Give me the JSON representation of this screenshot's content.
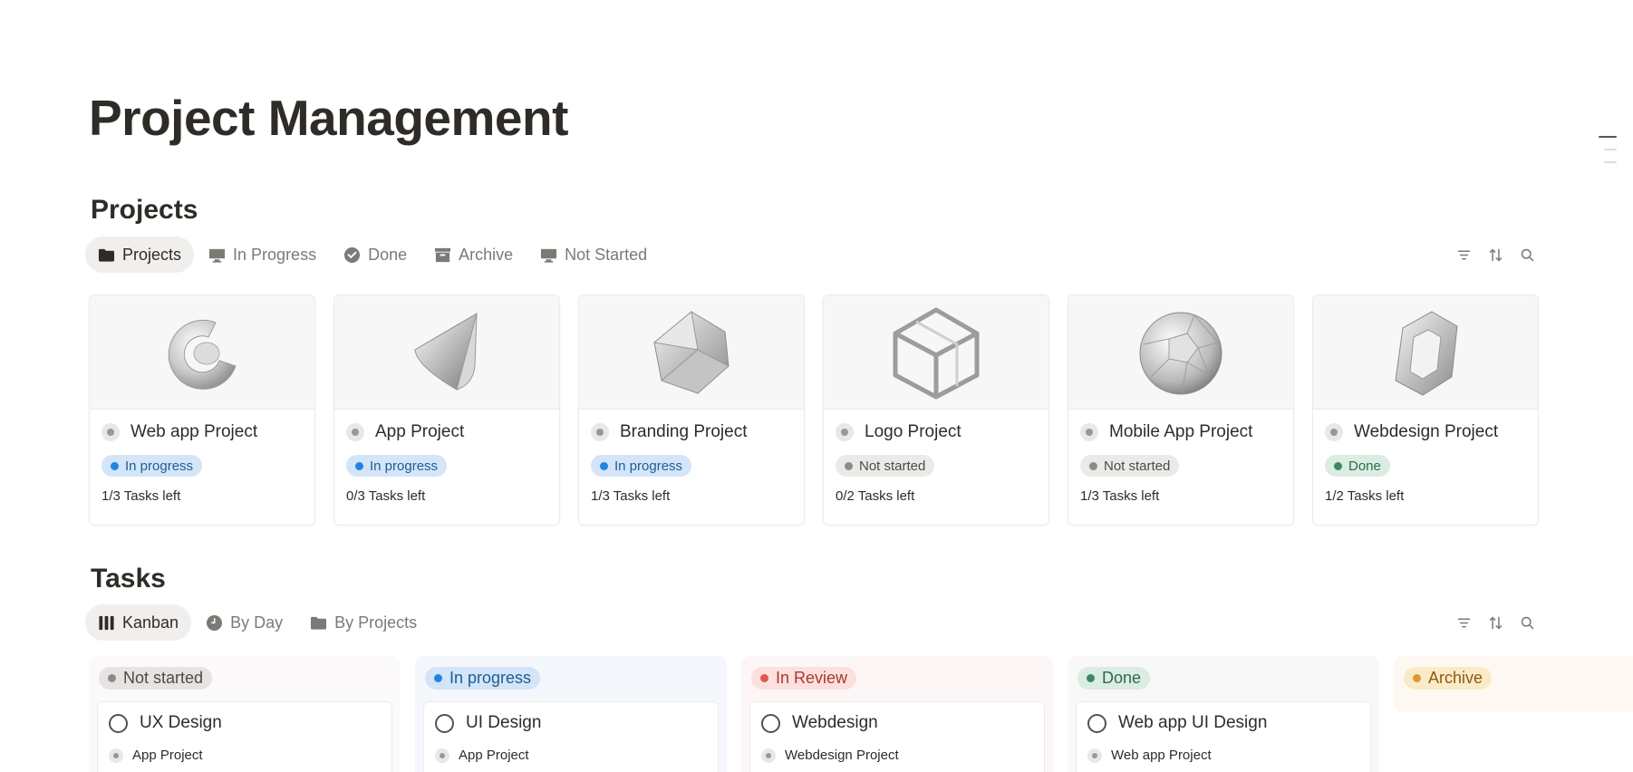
{
  "page": {
    "title": "Project Management"
  },
  "projects_section": {
    "title": "Projects",
    "tabs": [
      {
        "label": "Projects",
        "icon": "folder-icon",
        "active": true
      },
      {
        "label": "In Progress",
        "icon": "monitor-icon",
        "active": false
      },
      {
        "label": "Done",
        "icon": "check-circle-icon",
        "active": false
      },
      {
        "label": "Archive",
        "icon": "archive-box-icon",
        "active": false
      },
      {
        "label": "Not Started",
        "icon": "monitor-icon",
        "active": false
      }
    ],
    "actions": [
      "filter-icon",
      "sort-icon",
      "search-icon"
    ],
    "cards": [
      {
        "title": "Web app Project",
        "status": "In progress",
        "status_color": "#2383e2",
        "status_bg": "#d3e5f7",
        "tasks": "1/3 Tasks left",
        "cover": "glass-c-shape"
      },
      {
        "title": "App Project",
        "status": "In progress",
        "status_color": "#2383e2",
        "status_bg": "#d3e5f7",
        "tasks": "0/3 Tasks left",
        "cover": "glass-cone"
      },
      {
        "title": "Branding Project",
        "status": "In progress",
        "status_color": "#2383e2",
        "status_bg": "#d3e5f7",
        "tasks": "1/3 Tasks left",
        "cover": "glass-polyhedron"
      },
      {
        "title": "Logo Project",
        "status": "Not started",
        "status_color": "#8e8b86",
        "status_bg": "#ebeae8",
        "tasks": "0/2 Tasks left",
        "cover": "glass-wire-cube"
      },
      {
        "title": "Mobile App Project",
        "status": "Not started",
        "status_color": "#8e8b86",
        "status_bg": "#ebeae8",
        "tasks": "1/3 Tasks left",
        "cover": "glass-sphere"
      },
      {
        "title": "Webdesign Project",
        "status": "Done",
        "status_color": "#3b8a63",
        "status_bg": "#dbece2",
        "tasks": "1/2 Tasks left",
        "cover": "glass-hexagon"
      }
    ]
  },
  "tasks_section": {
    "title": "Tasks",
    "tabs": [
      {
        "label": "Kanban",
        "icon": "kanban-columns-icon",
        "active": true
      },
      {
        "label": "By Day",
        "icon": "clock-icon",
        "active": false
      },
      {
        "label": "By Projects",
        "icon": "folder-icon",
        "active": false
      }
    ],
    "actions": [
      "filter-icon",
      "sort-icon",
      "search-icon"
    ],
    "columns": [
      {
        "label": "Not started",
        "dot": "#8e8b86",
        "badge_bg": "#e6e4e2",
        "col_bg": "#fbf9f9",
        "task": {
          "title": "UX Design",
          "project": "App Project"
        }
      },
      {
        "label": "In progress",
        "dot": "#2383e2",
        "badge_bg": "#d3e5f7",
        "col_bg": "#f4f8fd",
        "task": {
          "title": "UI Design",
          "project": "App Project"
        }
      },
      {
        "label": "In Review",
        "dot": "#e2574c",
        "badge_bg": "#fbe0dd",
        "col_bg": "#fdf6f6",
        "task": {
          "title": "Webdesign",
          "project": "Webdesign Project"
        }
      },
      {
        "label": "Done",
        "dot": "#3b8a63",
        "badge_bg": "#dbece2",
        "col_bg": "#f8f8f8",
        "task": {
          "title": "Web app UI Design",
          "project": "Web app Project"
        }
      },
      {
        "label": "Archive",
        "dot": "#dc9b32",
        "badge_bg": "#fbeac8",
        "col_bg": "#fdf9f2",
        "task": null
      }
    ]
  }
}
